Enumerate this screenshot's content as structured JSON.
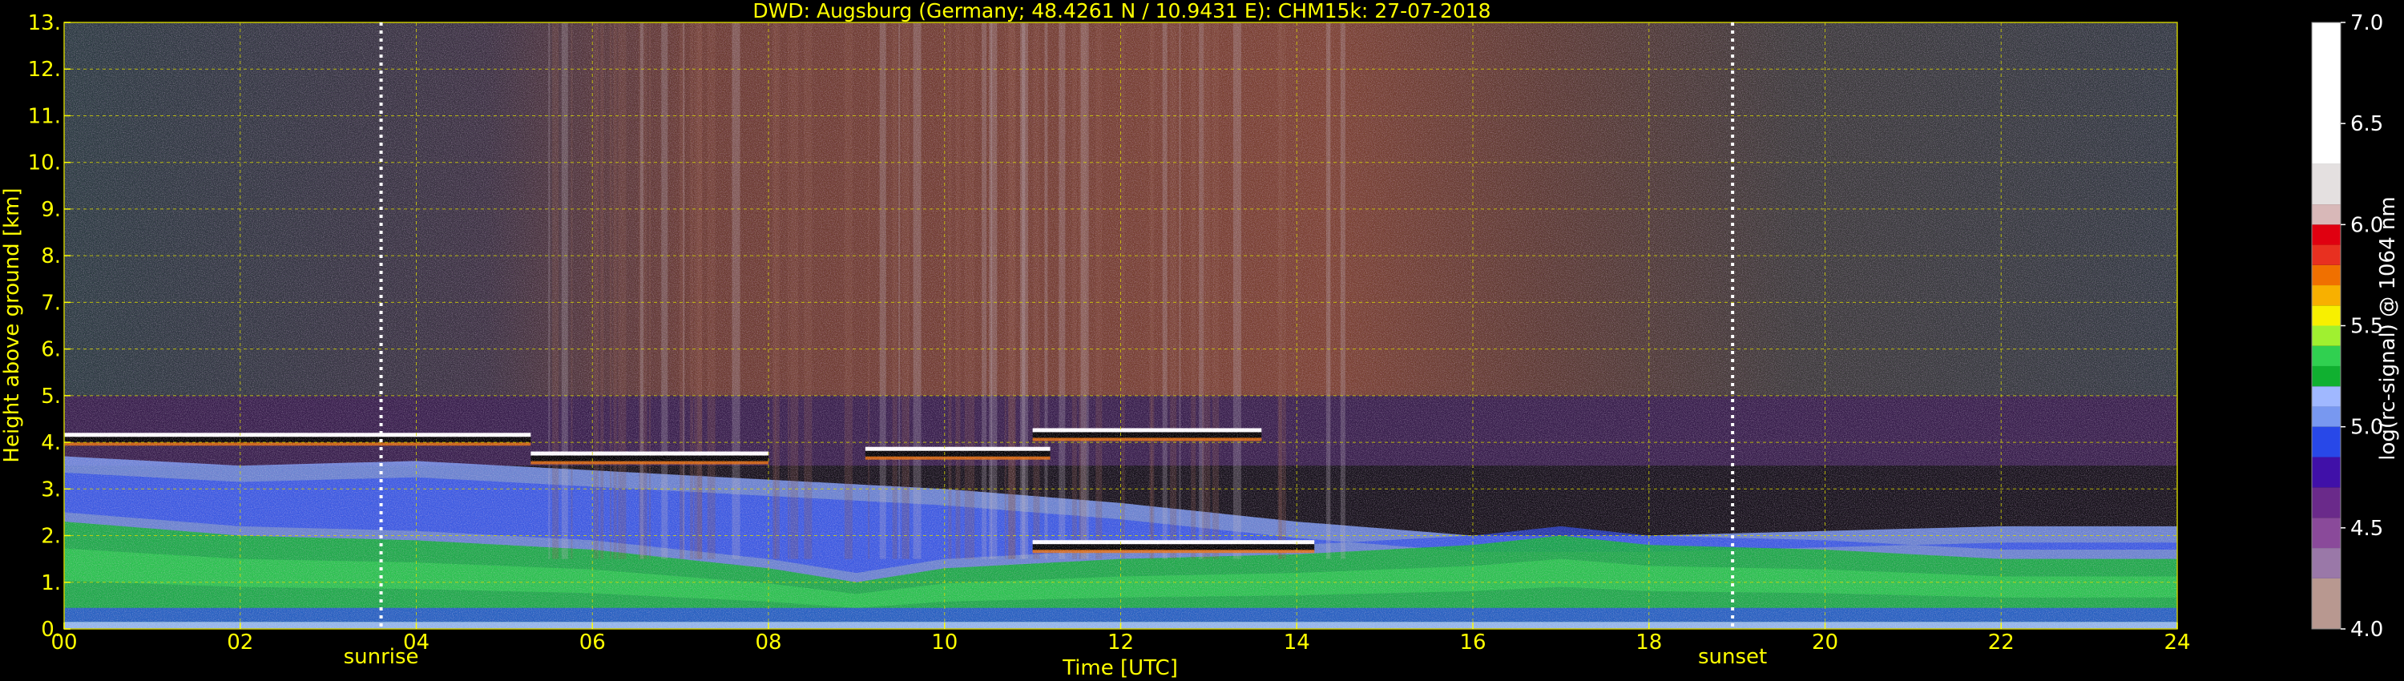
{
  "chart_data": {
    "type": "heatmap",
    "title": "DWD: Augsburg (Germany; 48.4261 N / 10.9431 E):    CHM15k: 27-07-2018",
    "xlabel": "Time [UTC]",
    "ylabel": "Height above ground [km]",
    "xlim": [
      0,
      24
    ],
    "ylim": [
      0,
      13
    ],
    "x_ticks": [
      {
        "value": 0,
        "label": "00"
      },
      {
        "value": 2,
        "label": "02"
      },
      {
        "value": 4,
        "label": "04"
      },
      {
        "value": 6,
        "label": "06"
      },
      {
        "value": 8,
        "label": "08"
      },
      {
        "value": 10,
        "label": "10"
      },
      {
        "value": 12,
        "label": "12"
      },
      {
        "value": 14,
        "label": "14"
      },
      {
        "value": 16,
        "label": "16"
      },
      {
        "value": 18,
        "label": "18"
      },
      {
        "value": 20,
        "label": "20"
      },
      {
        "value": 22,
        "label": "22"
      },
      {
        "value": 24,
        "label": "24"
      }
    ],
    "y_ticks": [
      {
        "value": 0,
        "label": "0."
      },
      {
        "value": 1,
        "label": "1."
      },
      {
        "value": 2,
        "label": "2."
      },
      {
        "value": 3,
        "label": "3."
      },
      {
        "value": 4,
        "label": "4."
      },
      {
        "value": 5,
        "label": "5."
      },
      {
        "value": 6,
        "label": "6."
      },
      {
        "value": 7,
        "label": "7."
      },
      {
        "value": 8,
        "label": "8."
      },
      {
        "value": 9,
        "label": "9."
      },
      {
        "value": 10,
        "label": "10."
      },
      {
        "value": 11,
        "label": "11."
      },
      {
        "value": 12,
        "label": "12."
      },
      {
        "value": 13,
        "label": "13."
      }
    ],
    "grid": true,
    "annotations": [
      {
        "label": "sunrise",
        "x": 3.6
      },
      {
        "label": "sunset",
        "x": 18.95
      }
    ],
    "colorbar": {
      "label": "log(rc-signal) @ 1064 nm",
      "range": [
        4.0,
        7.0
      ],
      "ticks": [
        {
          "value": 4.0,
          "label": "4.0"
        },
        {
          "value": 4.5,
          "label": "4.5"
        },
        {
          "value": 5.0,
          "label": "5.0"
        },
        {
          "value": 5.5,
          "label": "5.5"
        },
        {
          "value": 6.0,
          "label": "6.0"
        },
        {
          "value": 6.5,
          "label": "6.5"
        },
        {
          "value": 7.0,
          "label": "7.0"
        }
      ],
      "bands": [
        {
          "from": 4.0,
          "to": 4.25,
          "color": "#b89890"
        },
        {
          "from": 4.25,
          "to": 4.4,
          "color": "#9a78a8"
        },
        {
          "from": 4.4,
          "to": 4.55,
          "color": "#8a4a9a"
        },
        {
          "from": 4.55,
          "to": 4.7,
          "color": "#6a2a8a"
        },
        {
          "from": 4.7,
          "to": 4.85,
          "color": "#4010a8"
        },
        {
          "from": 4.85,
          "to": 5.0,
          "color": "#2848e8"
        },
        {
          "from": 5.0,
          "to": 5.1,
          "color": "#7898f0"
        },
        {
          "from": 5.1,
          "to": 5.2,
          "color": "#a0b8ff"
        },
        {
          "from": 5.2,
          "to": 5.3,
          "color": "#10b030"
        },
        {
          "from": 5.3,
          "to": 5.4,
          "color": "#30d050"
        },
        {
          "from": 5.4,
          "to": 5.5,
          "color": "#a0f030"
        },
        {
          "from": 5.5,
          "to": 5.6,
          "color": "#f8f000"
        },
        {
          "from": 5.6,
          "to": 5.7,
          "color": "#f8b000"
        },
        {
          "from": 5.7,
          "to": 5.8,
          "color": "#f07000"
        },
        {
          "from": 5.8,
          "to": 5.9,
          "color": "#e83020"
        },
        {
          "from": 5.9,
          "to": 6.0,
          "color": "#e00010"
        },
        {
          "from": 6.0,
          "to": 6.1,
          "color": "#d8b8b8"
        },
        {
          "from": 6.1,
          "to": 6.3,
          "color": "#e4e0e0"
        },
        {
          "from": 6.3,
          "to": 7.0,
          "color": "#ffffff"
        }
      ]
    },
    "field": {
      "cloud_layers": [
        {
          "t": [
            0.0,
            5.3
          ],
          "height_km": 4.1
        },
        {
          "t": [
            5.3,
            8.0
          ],
          "height_km": 3.7
        },
        {
          "t": [
            9.1,
            11.2
          ],
          "height_km": 3.8
        },
        {
          "t": [
            11.0,
            13.6
          ],
          "height_km": 4.2
        },
        {
          "t": [
            11.0,
            14.2
          ],
          "height_km": 1.8
        }
      ],
      "boundary_layer_top_km": [
        [
          0,
          3.7
        ],
        [
          2,
          3.5
        ],
        [
          4,
          3.6
        ],
        [
          6,
          3.4
        ],
        [
          8,
          3.2
        ],
        [
          10,
          3.0
        ],
        [
          12,
          2.7
        ],
        [
          14,
          2.3
        ],
        [
          16,
          2.0
        ],
        [
          18,
          2.0
        ],
        [
          20,
          2.1
        ],
        [
          22,
          2.2
        ],
        [
          24,
          2.2
        ]
      ],
      "mixed_layer_top_km": [
        [
          0,
          2.3
        ],
        [
          2,
          2.0
        ],
        [
          4,
          1.9
        ],
        [
          6,
          1.7
        ],
        [
          8,
          1.3
        ],
        [
          9,
          1.0
        ],
        [
          10,
          1.3
        ],
        [
          12,
          1.5
        ],
        [
          14,
          1.6
        ],
        [
          16,
          1.8
        ],
        [
          17,
          2.0
        ],
        [
          18,
          1.8
        ],
        [
          20,
          1.7
        ],
        [
          22,
          1.5
        ],
        [
          24,
          1.5
        ]
      ]
    }
  },
  "colors": {
    "accent": "#ffff00",
    "background": "#000000",
    "grid": "#d8d800",
    "sun_marker": "#ffffff"
  }
}
